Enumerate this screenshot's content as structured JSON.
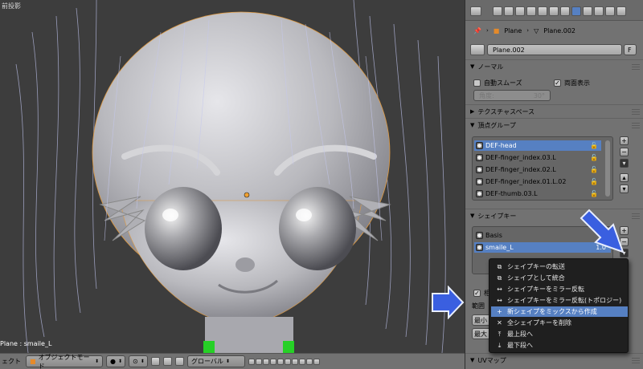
{
  "viewport": {
    "corner_label": "前投影",
    "object_info": "Plane : smaile_L",
    "header": {
      "editor_label": "ェクト",
      "mode_label": "オブジェクトモード",
      "orientation_label": "グローバル"
    }
  },
  "properties": {
    "breadcrumb": {
      "object": "Plane",
      "mesh": "Plane.002"
    },
    "datablock": {
      "name": "Plane.002",
      "fake_user": "F"
    },
    "normals": {
      "title": "ノーマル",
      "auto_smooth": "自動スムーズ",
      "double_sided": "両面表示",
      "angle_label": "角度:",
      "angle_value": "30°"
    },
    "texture_space": {
      "title": "テクスチャスペース"
    },
    "vertex_groups": {
      "title": "頂点グループ",
      "items": [
        "DEF-head",
        "DEF-finger_index.03.L",
        "DEF-finger_index.02.L",
        "DEF-finger_index.01.L.02",
        "DEF-thumb.03.L"
      ]
    },
    "shape_keys": {
      "title": "シェイプキー",
      "items": [
        {
          "name": "Basis",
          "value": ""
        },
        {
          "name": "smaile_L",
          "value": "1.0"
        }
      ],
      "relative_label": "相",
      "range_label": "範囲",
      "min_label": "最小",
      "max_label": "最大"
    },
    "uv_maps": {
      "title": "UVマップ"
    }
  },
  "context_menu": {
    "items": [
      {
        "label": "シェイプキーの転送",
        "icon": "copy-icon",
        "highlighted": false
      },
      {
        "label": "シェイプとして統合",
        "icon": "copy-icon",
        "highlighted": false
      },
      {
        "label": "シェイプキーをミラー反転",
        "icon": "mirror-icon",
        "highlighted": false
      },
      {
        "label": "シェイプキーをミラー反転(トポロジー)",
        "icon": "mirror-icon",
        "highlighted": false
      },
      {
        "label": "新シェイプをミックスから作成",
        "icon": "plus-icon",
        "highlighted": true
      },
      {
        "label": "全シェイプキーを削除",
        "icon": "x-icon",
        "highlighted": false
      },
      {
        "label": "最上段へ",
        "icon": "top-icon",
        "highlighted": false
      },
      {
        "label": "最下段へ",
        "icon": "bottom-icon",
        "highlighted": false
      }
    ]
  },
  "colors": {
    "selection": "#5680c2",
    "annotation_arrow": "#3a5fe0",
    "panel_bg": "#727272",
    "menu_bg": "#1f1f1f"
  }
}
